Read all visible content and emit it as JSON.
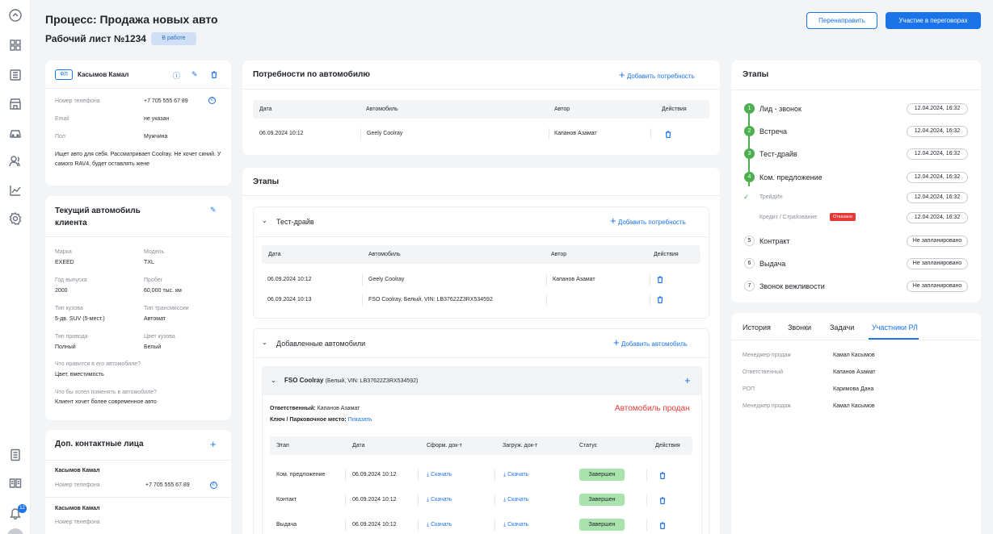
{
  "header": {
    "title": "Процесс: Продажа новых авто",
    "worksheet": "Рабочий лист №1234",
    "status": "В работе",
    "redirect_btn": "Перенаправить",
    "negotiate_btn": "Участие в переговорах"
  },
  "nav": {
    "notifications": "12"
  },
  "client": {
    "type_badge": "ФЛ",
    "name": "Касымов Камал",
    "phone_label": "Номер телефона",
    "phone": "+7 705 555 67 89",
    "email_label": "Email",
    "email": "не указан",
    "gender_label": "Пол",
    "gender": "Мужчина",
    "note": "Ищет авто для себя. Рассматривает Coolray. Не хочет синий. У самого RAV4, будет оставлять жене"
  },
  "current_car": {
    "title": "Текущий автомобиль клиента",
    "fields": [
      {
        "label": "Марка",
        "value": "EXEED"
      },
      {
        "label": "Модель",
        "value": "TXL"
      },
      {
        "label": "Год выпуска",
        "value": "2000"
      },
      {
        "label": "Пробег",
        "value": "60,000 тыс. км"
      },
      {
        "label": "Тип кузова",
        "value": "5-дв. SUV (5-мест.)"
      },
      {
        "label": "Тип трансмиссии",
        "value": "Автомат"
      },
      {
        "label": "Тип привода",
        "value": "Полный"
      },
      {
        "label": "Цвет кузова",
        "value": "Белый"
      }
    ],
    "likes_label": "Что нравится в его автомобиле?",
    "likes": "Цвет, вместимость",
    "change_label": "Что бы хотел поменять в автомобиле?",
    "change": "Клиент хочет более современное авто"
  },
  "contacts": {
    "title": "Доп. контактные лица",
    "items": [
      {
        "name": "Касымов Камал",
        "phone_label": "Номер телефона",
        "phone": "+7 705 555 67 89"
      },
      {
        "name": "Касымов Камал",
        "phone_label": "Номер телефона",
        "phone": ""
      }
    ]
  },
  "needs": {
    "title": "Потребности по автомобилю",
    "add": "Добавить потребность",
    "cols": [
      "Дата",
      "Автомобиль",
      "Автор",
      "Действия"
    ],
    "rows": [
      {
        "date": "06.09.2024 10:12",
        "car": "Geely Coolray",
        "author": "Капанов Азамат"
      }
    ]
  },
  "stages_mid": {
    "title": "Этапы",
    "testdrive": {
      "title": "Тест-драйв",
      "add": "Добавить потребность",
      "cols": [
        "Дата",
        "Автомобиль",
        "Автор",
        "Действия"
      ],
      "rows": [
        {
          "date": "06.09.2024 10:12",
          "car": "Geely Coolray",
          "author": "Капанов Азамат"
        },
        {
          "date": "06.09.2024 10:13",
          "car": "FSO Coolray, Белый, VIN: LB37622Z3RX534592",
          "author": ""
        }
      ]
    },
    "added": {
      "title": "Добавленные автомобили",
      "add": "Добавить автомобиль",
      "car_name": "FSO Coolray",
      "car_details": "(Белый, VIN: LB37622Z3RX534592)",
      "responsible_label": "Ответственный:",
      "responsible": "Капанов Азамат",
      "key_label": "Ключ / Парковочное место:",
      "key_link": "Показать",
      "sold": "Автомобиль продан",
      "cols": [
        "Этап",
        "Дата",
        "Сформ. док-т",
        "Загруж. док-т",
        "Статус",
        "Действия"
      ],
      "download": "Скачать",
      "rows": [
        {
          "stage": "Ком. предложение",
          "date": "06.09.2024 10:12",
          "status": "Завершен"
        },
        {
          "stage": "Контакт",
          "date": "06.09.2024 10:12",
          "status": "Завершен"
        },
        {
          "stage": "Выдача",
          "date": "06.09.2024 10:12",
          "status": "Завершен"
        }
      ]
    }
  },
  "stages_right": {
    "title": "Этапы",
    "items": [
      {
        "num": "1",
        "label": "Лид - звонок",
        "date": "12.04.2024, 16:32",
        "done": true
      },
      {
        "num": "2",
        "label": "Встреча",
        "date": "12.04.2024, 16:32",
        "done": true
      },
      {
        "num": "3",
        "label": "Тест-драйв",
        "date": "12.04.2024, 16:32",
        "done": true
      },
      {
        "num": "4",
        "label": "Ком. предложение",
        "date": "12.04.2024, 16:32",
        "done": true
      },
      {
        "num": "",
        "label": "ТрейдИн",
        "date": "12.04.2024, 16:32",
        "sub": true
      },
      {
        "num": "",
        "label": "Кредит / Страхование",
        "date": "12.04.2024, 16:32",
        "sub": true,
        "tag": "Отказано"
      },
      {
        "num": "5",
        "label": "Контракт",
        "date": "Не запланировано"
      },
      {
        "num": "6",
        "label": "Выдача",
        "date": "Не запланировано"
      },
      {
        "num": "7",
        "label": "Звонок вежливости",
        "date": "Не запланировано"
      }
    ]
  },
  "participants": {
    "tabs": [
      "История",
      "Звонки",
      "Задачи",
      "Участники РЛ"
    ],
    "active_tab": "Участники РЛ",
    "rows": [
      {
        "role": "Менеджер продаж",
        "name": "Камал Касымов"
      },
      {
        "role": "Ответственный",
        "name": "Капанов Азамат"
      },
      {
        "role": "РОП",
        "name": "Каримова Дана"
      },
      {
        "role": "Менеджер продаж",
        "name": "Камал Касымов"
      }
    ]
  },
  "colors": {
    "accent": "#1a73e8",
    "success": "#4caf50",
    "danger": "#e53935",
    "status_done": "#a8e2ad"
  }
}
